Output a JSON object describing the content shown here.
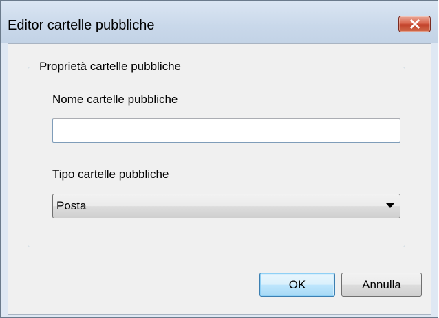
{
  "window": {
    "title": "Editor cartelle pubbliche",
    "close_icon": "close-icon"
  },
  "group": {
    "legend": "Proprietà cartelle pubbliche"
  },
  "fields": {
    "name_label": "Nome cartelle pubbliche",
    "name_value": "",
    "type_label": "Tipo cartelle pubbliche",
    "type_selected": "Posta",
    "type_arrow_icon": "chevron-down-icon"
  },
  "buttons": {
    "ok_label": "OK",
    "cancel_label": "Annulla"
  },
  "colors": {
    "title_bar": "#c9d8ea",
    "close_button": "#c1412a",
    "client_background": "#f0f0f0",
    "default_button_border": "#3c7fb1"
  }
}
